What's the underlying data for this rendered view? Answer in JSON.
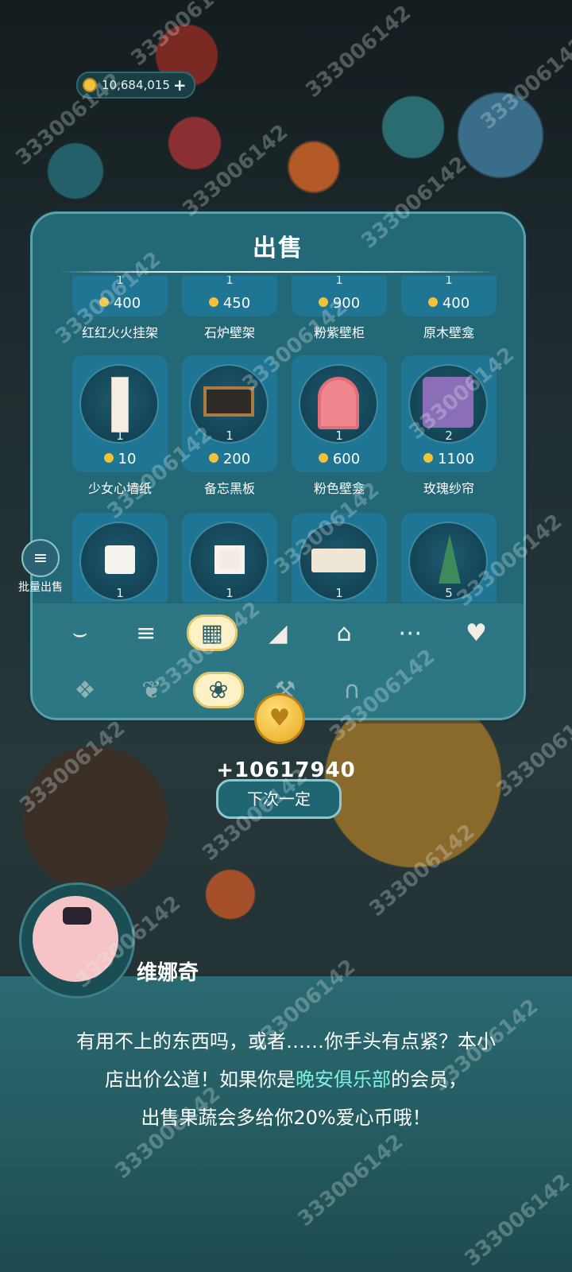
{
  "currency": {
    "amount": "10,684,015",
    "plus": "+",
    "icon": "coin-icon"
  },
  "panel": {
    "title": "出售",
    "items": [
      {
        "qty": "1",
        "price": "400",
        "name": "红红火火挂架"
      },
      {
        "qty": "1",
        "price": "450",
        "name": "石炉壁架"
      },
      {
        "qty": "1",
        "price": "900",
        "name": "粉紫壁柜"
      },
      {
        "qty": "1",
        "price": "400",
        "name": "原木壁龛"
      },
      {
        "qty": "1",
        "price": "10",
        "name": "少女心墙纸"
      },
      {
        "qty": "1",
        "price": "200",
        "name": "备忘黑板"
      },
      {
        "qty": "1",
        "price": "600",
        "name": "粉色壁龛"
      },
      {
        "qty": "2",
        "price": "1100",
        "name": "玫瑰纱帘"
      },
      {
        "qty": "1"
      },
      {
        "qty": "1"
      },
      {
        "qty": "1"
      },
      {
        "qty": "5"
      }
    ],
    "category_tabs": [
      "sofa-icon",
      "bed-icon",
      "cabinet-icon",
      "hat-icon",
      "house-icon",
      "more-icon",
      "heart-icon"
    ],
    "subcategory_tabs": [
      "grid-icon",
      "plant-icon",
      "lantern-icon",
      "tools-icon",
      "hanger-icon"
    ]
  },
  "side": {
    "bulk_sell_label": "批量出售"
  },
  "reward": {
    "gain": "+10617940",
    "next_button": "下次一定"
  },
  "dialog": {
    "speaker": "维娜奇",
    "line1": "有用不上的东西吗，或者……你手头有点紧？本小",
    "line2_a": "店出价公道！如果你是",
    "line2_highlight": "晚安俱乐部",
    "line2_b": "的会员，",
    "line3": "出售果蔬会多给你20%爱心币哦！"
  },
  "watermark": "333006142"
}
